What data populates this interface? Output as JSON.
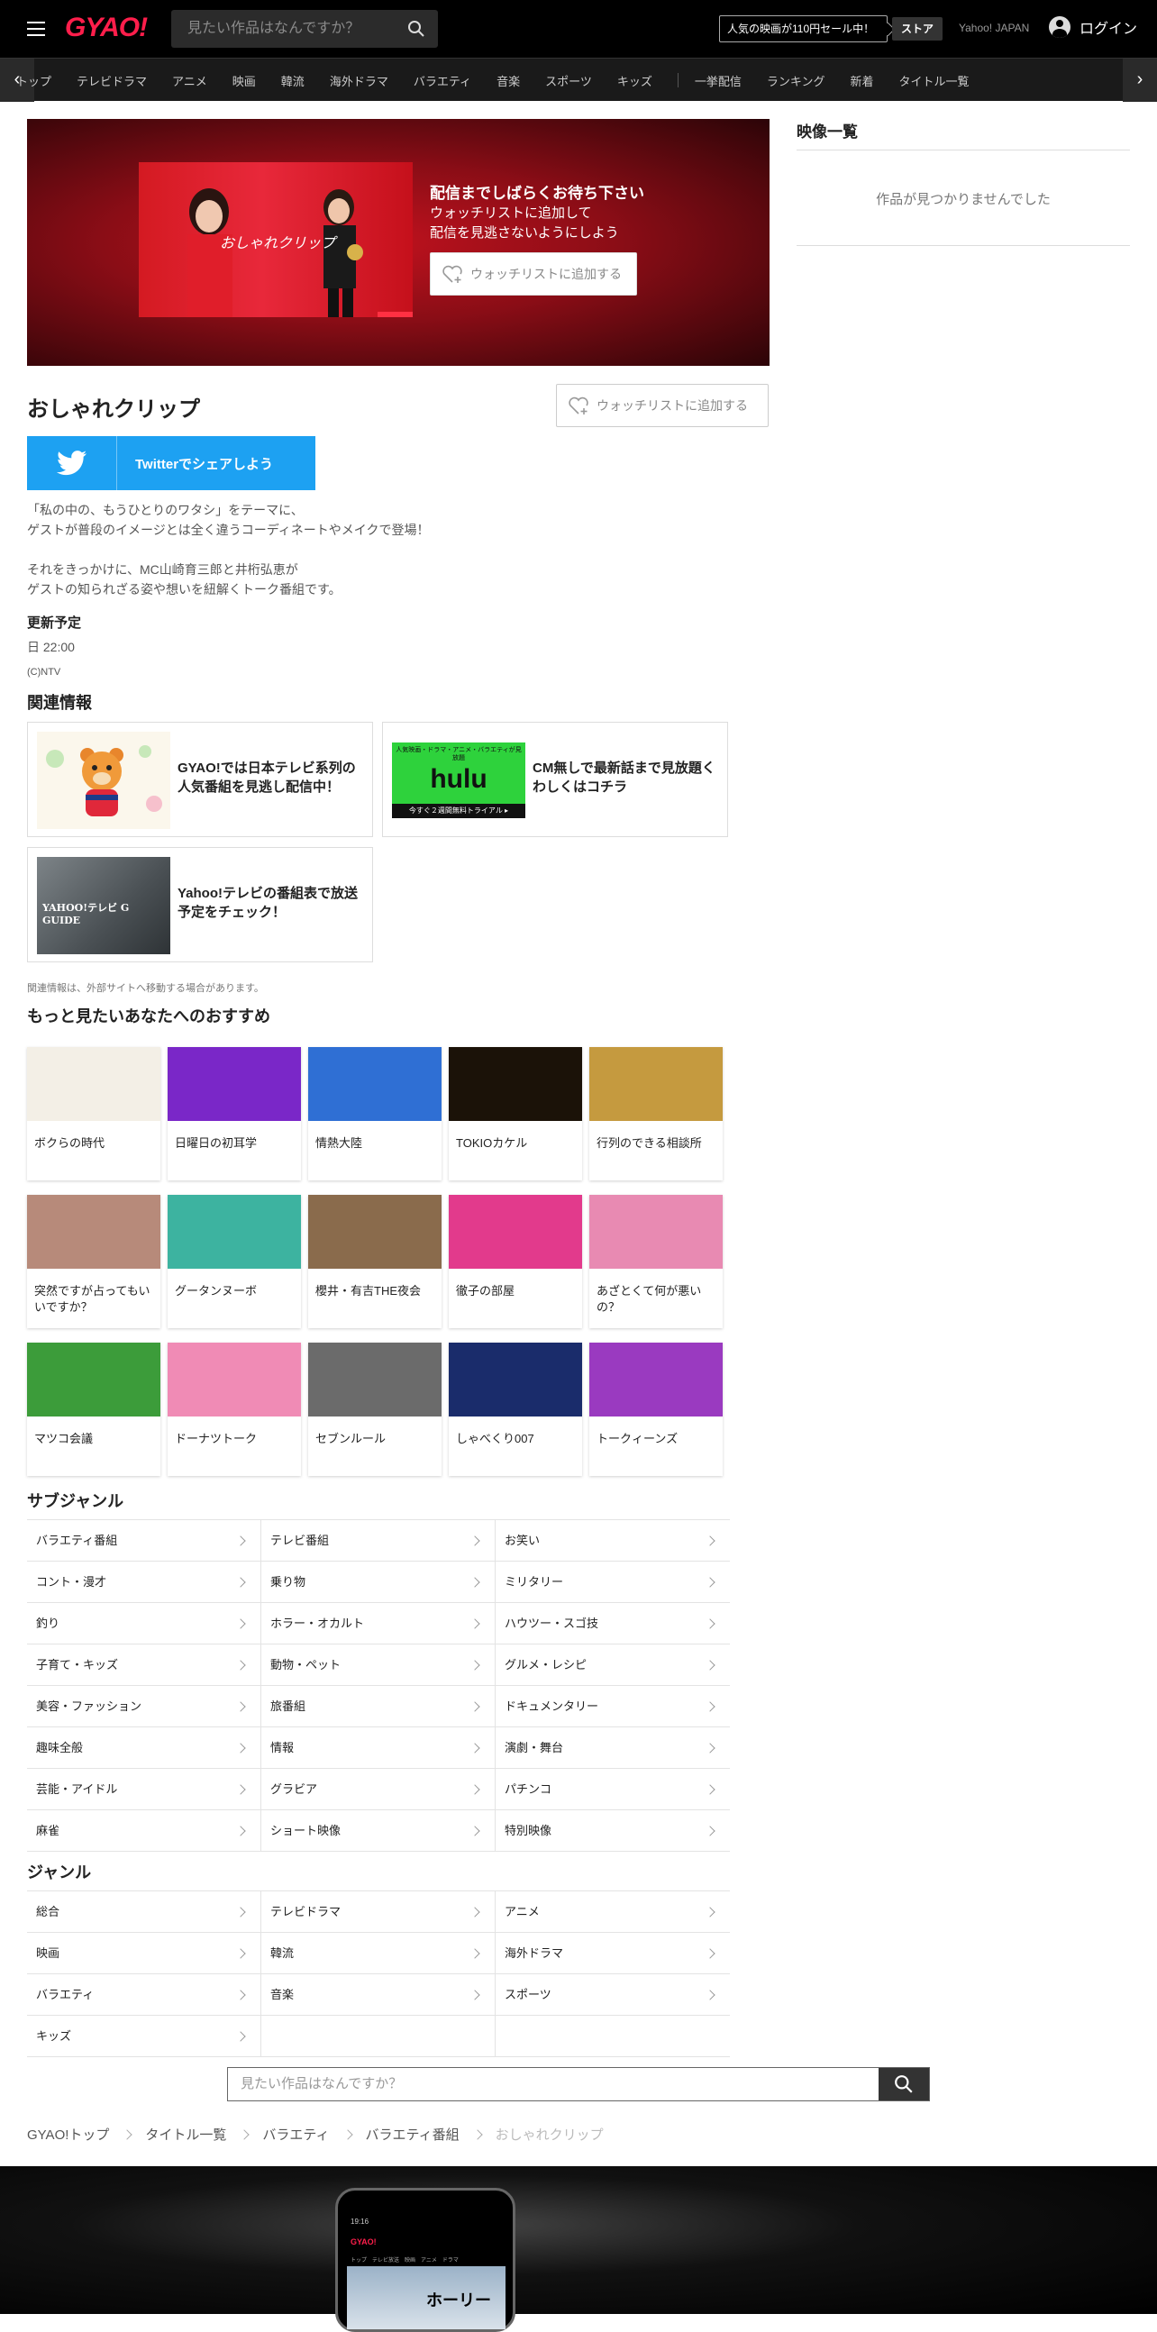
{
  "header": {
    "logo": "GYAO!",
    "search_placeholder": "見たい作品はなんですか？",
    "sale_banner": "人気の映画が110円セール中！",
    "store": "ストア",
    "yahoo": "Yahoo! JAPAN",
    "login": "ログイン"
  },
  "nav": {
    "items": [
      "トップ",
      "テレビドラマ",
      "アニメ",
      "映画",
      "韓流",
      "海外ドラマ",
      "バラエティ",
      "音楽",
      "スポーツ",
      "キッズ"
    ],
    "items2": [
      "一挙配信",
      "ランキング",
      "新着",
      "タイトル一覧"
    ]
  },
  "hero": {
    "title": "配信までしばらくお待ち下さい",
    "line1": "ウォッチリストに追加して",
    "line2": "配信を見逃さないようにしよう",
    "watchlist_button": "ウォッチリストに追加する",
    "image_text": "おしゃれクリップ"
  },
  "program": {
    "title": "おしゃれクリップ",
    "watchlist_button": "ウォッチリストに追加する",
    "twitter_button": "Twitterでシェアしよう",
    "desc1": "「私の中の、もうひとりのワタシ」をテーマに、",
    "desc2": "ゲストが普段のイメージとは全く違うコーディネートやメイクで登場！",
    "desc3": "それをきっかけに、MC山崎育三郎と井桁弘恵が",
    "desc4": "ゲストの知られざる姿や想いを紐解くトーク番組です。",
    "update_heading": "更新予定",
    "update_value": "日 22:00",
    "copyright": "(C)NTV"
  },
  "related": {
    "heading": "関連情報",
    "items": [
      {
        "text": "GYAO!では日本テレビ系列の人気番組を見逃し配信中！"
      },
      {
        "text": "CM無しで最新話まで見放題くわしくはコチラ",
        "banner_top": "人気映画・ドラマ・アニメ・バラエティが見放題",
        "banner_logo": "hulu",
        "banner_bottom": "今すぐ２週間無料トライアル ▸"
      },
      {
        "text": "Yahoo!テレビの番組表で放送予定をチェック！",
        "banner_logo": "YAHOO!テレビ G GUIDE"
      }
    ],
    "note": "関連情報は、外部サイトへ移動する場合があります。"
  },
  "recommend": {
    "heading": "もっと見たいあなたへのおすすめ",
    "items": [
      {
        "title": "ボクらの時代",
        "color": "#f3efe6"
      },
      {
        "title": "日曜日の初耳学",
        "color": "#7a27c8"
      },
      {
        "title": "情熱大陸",
        "color": "#2f6fd4"
      },
      {
        "title": "TOKIOカケル",
        "color": "#1b1208"
      },
      {
        "title": "行列のできる相談所",
        "color": "#c59a3f"
      },
      {
        "title": "突然ですが占ってもいいですか？",
        "color": "#b78a7a"
      },
      {
        "title": "グータンヌーボ",
        "color": "#3db3a0"
      },
      {
        "title": "櫻井・有吉THE夜会",
        "color": "#8a6b4c"
      },
      {
        "title": "徹子の部屋",
        "color": "#e23a8c"
      },
      {
        "title": "あざとくて何が悪いの？",
        "color": "#e88ab2"
      },
      {
        "title": "マツコ会議",
        "color": "#3c9c3a"
      },
      {
        "title": "ドーナツトーク",
        "color": "#f08bb5"
      },
      {
        "title": "セブンルール",
        "color": "#6b6b6b"
      },
      {
        "title": "しゃべくり007",
        "color": "#1a2c6b"
      },
      {
        "title": "トークィーンズ",
        "color": "#9a3ac0"
      }
    ]
  },
  "subgenre": {
    "heading": "サブジャンル",
    "items": [
      "バラエティ番組",
      "テレビ番組",
      "お笑い",
      "コント・漫才",
      "乗り物",
      "ミリタリー",
      "釣り",
      "ホラー・オカルト",
      "ハウツー・スゴ技",
      "子育て・キッズ",
      "動物・ペット",
      "グルメ・レシピ",
      "美容・ファッション",
      "旅番組",
      "ドキュメンタリー",
      "趣味全般",
      "情報",
      "演劇・舞台",
      "芸能・アイドル",
      "グラビア",
      "パチンコ",
      "麻雀",
      "ショート映像",
      "特別映像"
    ]
  },
  "genre": {
    "heading": "ジャンル",
    "items": [
      "総合",
      "テレビドラマ",
      "アニメ",
      "映画",
      "韓流",
      "海外ドラマ",
      "バラエティ",
      "音楽",
      "スポーツ",
      "キッズ"
    ]
  },
  "bottom_search": {
    "placeholder": "見たい作品はなんですか？"
  },
  "breadcrumb": [
    "GYAO!トップ",
    "タイトル一覧",
    "バラエティ",
    "バラエティ番組",
    "おしゃれクリップ"
  ],
  "sidebar": {
    "heading": "映像一覧",
    "empty": "作品が見つかりませんでした"
  },
  "footer": {
    "phone_logo": "GYAO!",
    "phone_time": "19:16",
    "phone_tabs": "トップ　テレビ放送　映画　アニメ　ドラマ",
    "phone_image_text": "ホーリー"
  }
}
